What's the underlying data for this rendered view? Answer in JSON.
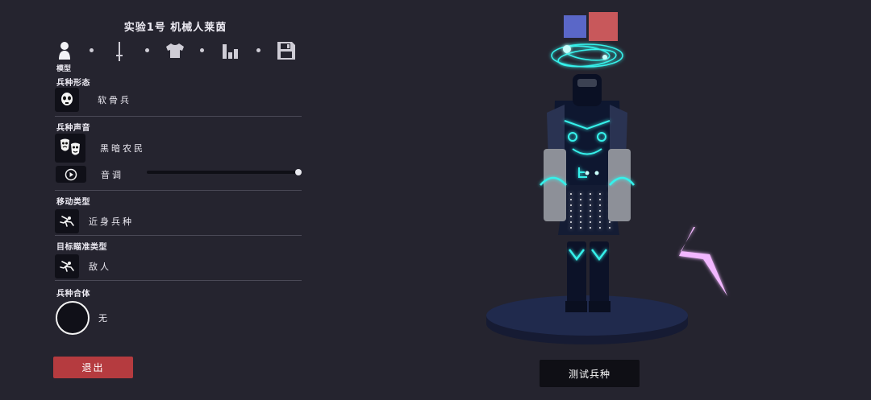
{
  "header": {
    "title": "实验1号  机械人莱茵"
  },
  "toolbar": {
    "tabs": [
      {
        "icon": "person-icon",
        "label": "模型"
      },
      {
        "icon": "sword-icon",
        "label": ""
      },
      {
        "icon": "shirt-icon",
        "label": ""
      },
      {
        "icon": "bars-icon",
        "label": ""
      },
      {
        "icon": "save-icon",
        "label": ""
      }
    ],
    "active_tab_label": "模型"
  },
  "sections": {
    "form": {
      "label": "兵种形态",
      "value": "软骨兵",
      "icon": "skull-mask-icon"
    },
    "voice": {
      "label": "兵种声音",
      "value": "黑暗农民",
      "icon": "masks-icon",
      "pitch_label": "音调",
      "pitch_level": 1.0
    },
    "movement": {
      "label": "移动类型",
      "value": "近身兵种",
      "icon": "charge-icon"
    },
    "targeting": {
      "label": "目标瞄准类型",
      "value": "敌人",
      "icon": "target-icon"
    },
    "merge": {
      "label": "兵种合体",
      "value": "无"
    }
  },
  "buttons": {
    "exit": "退出",
    "test": "测试兵种"
  },
  "colors": {
    "exit": "#b53b3f",
    "team_blue": "#5a67c8",
    "team_red": "#c8585b",
    "glow": "#2fe6e0",
    "lightning": "#f2b7ff"
  }
}
